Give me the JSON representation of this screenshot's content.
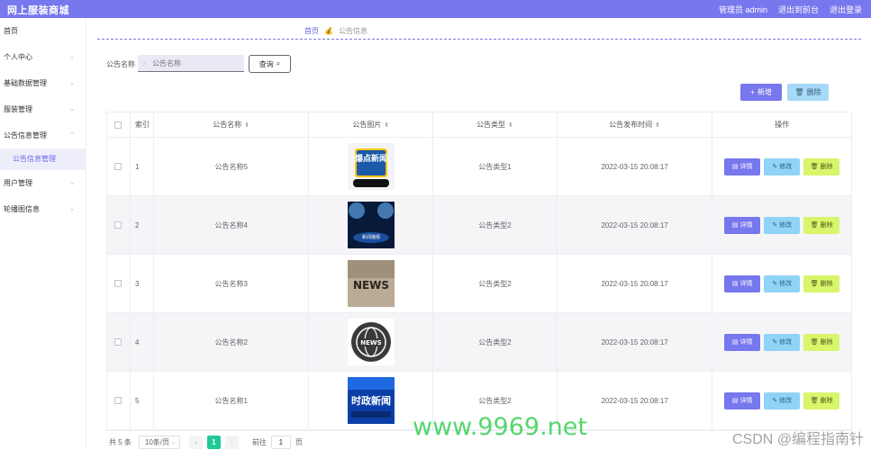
{
  "header": {
    "brand": "网上服装商城",
    "user_label": "管理员 admin",
    "front_link": "退出到前台",
    "logout_link": "退出登录"
  },
  "sidebar": {
    "items": [
      {
        "label": "首页"
      },
      {
        "label": "个人中心"
      },
      {
        "label": "基础数据管理"
      },
      {
        "label": "服装管理"
      },
      {
        "label": "公告信息管理"
      },
      {
        "label": "公告信息管理"
      },
      {
        "label": "用户管理"
      },
      {
        "label": "轮播图信息"
      }
    ]
  },
  "breadcrumb": {
    "home": "首页",
    "current": "公告信息"
  },
  "search": {
    "label": "公告名称",
    "placeholder": "公告名称",
    "query_label": "查询"
  },
  "actions": {
    "add_label": "新增",
    "delete_label": "删除"
  },
  "table": {
    "headers": [
      "索引",
      "公告名称",
      "公告图片",
      "公告类型",
      "公告发布时间",
      "操作"
    ],
    "rows": [
      {
        "index": "1",
        "name": "公告名称5",
        "image": "爆点新闻",
        "type": "公告类型1",
        "time": "2022-03-15 20:08:17"
      },
      {
        "index": "2",
        "name": "公告名称4",
        "image": "新闻播报",
        "type": "公告类型2",
        "time": "2022-03-15 20:08:17"
      },
      {
        "index": "3",
        "name": "公告名称3",
        "image": "NEWS",
        "type": "公告类型2",
        "time": "2022-03-15 20:08:17"
      },
      {
        "index": "4",
        "name": "公告名称2",
        "image": "NEWS",
        "type": "公告类型2",
        "time": "2022-03-15 20:08:17"
      },
      {
        "index": "5",
        "name": "公告名称1",
        "image": "时政新闻",
        "type": "公告类型2",
        "time": "2022-03-15 20:08:17"
      }
    ],
    "op_labels": {
      "detail": "详情",
      "edit": "修改",
      "remove": "删除"
    }
  },
  "pagination": {
    "total": "共 5 条",
    "page_size": "10条/页",
    "current_page": "1",
    "goto_label": "前往",
    "goto_value": "1",
    "page_unit": "页"
  },
  "watermarks": {
    "site": "www.9969.net",
    "csdn": "CSDN @编程指南针"
  },
  "colors": {
    "accent": "#7777ee",
    "edit": "#8fd3f6",
    "remove": "#d8f56b",
    "page_active": "#20c997"
  }
}
